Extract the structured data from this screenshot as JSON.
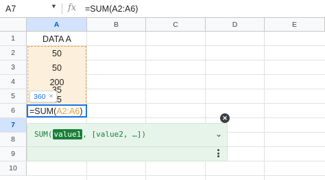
{
  "formula_bar": {
    "name_box": "A7",
    "fx_label": "fx",
    "formula": "=SUM(A2:A6)"
  },
  "columns": [
    "A",
    "B",
    "C",
    "D",
    "E"
  ],
  "rows": [
    "1",
    "2",
    "3",
    "4",
    "5",
    "6",
    "7",
    "8",
    "9",
    "10"
  ],
  "cells": {
    "a1": "DATA A",
    "a2": "50",
    "a3": "50",
    "a4": "200",
    "a5": "35",
    "a6": "25"
  },
  "editor": {
    "prefix": "=SUM(",
    "range": "A2:A6",
    "suffix": ")"
  },
  "preview": {
    "value": "360",
    "close": "×"
  },
  "function_help": {
    "prefix": "SUM(",
    "active_arg": "value1",
    "rest": ", [value2, …])"
  },
  "colors": {
    "selection": "#1a73e8",
    "range_ref": "#e8a13a",
    "help_bg": "#e6f4ea",
    "help_text": "#188038"
  }
}
